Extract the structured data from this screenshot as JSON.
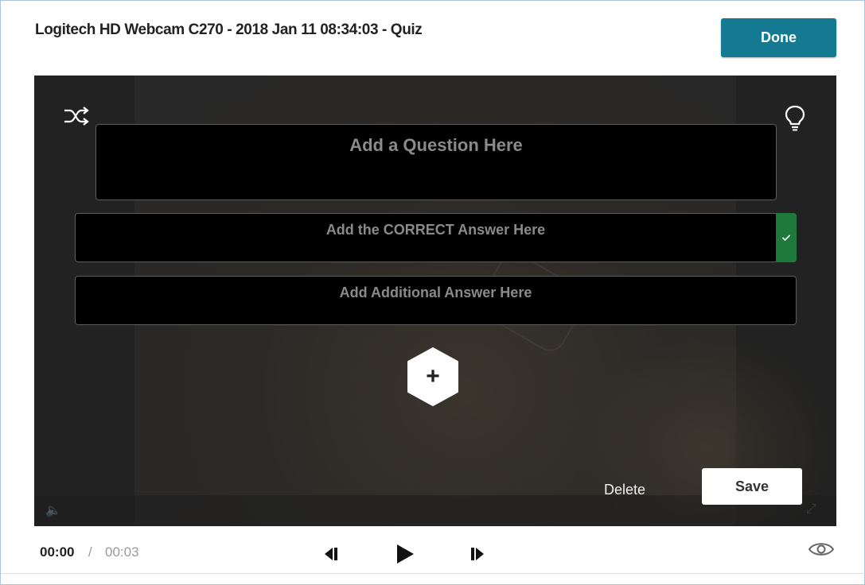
{
  "header": {
    "title": "Logitech HD Webcam C270 - 2018 Jan 11 08:34:03 - Quiz",
    "done_label": "Done"
  },
  "quiz": {
    "question_placeholder": "Add a Question Here",
    "correct_answer_placeholder": "Add the CORRECT Answer Here",
    "additional_answer_placeholder": "Add Additional Answer Here",
    "add_answer_symbol": "+",
    "delete_label": "Delete",
    "save_label": "Save"
  },
  "player": {
    "current_time": "00:00",
    "separator": "/",
    "total_time": "00:03"
  },
  "icons": {
    "shuffle": "shuffle-icon",
    "hint": "lightbulb-icon",
    "correct": "check-icon",
    "prev_frame": "step-back-icon",
    "play": "play-icon",
    "next_frame": "step-forward-icon",
    "preview": "eye-icon"
  },
  "colors": {
    "done_button": "#137a91",
    "correct_marker": "#1e7a3a",
    "overlay_box": "#000000"
  }
}
